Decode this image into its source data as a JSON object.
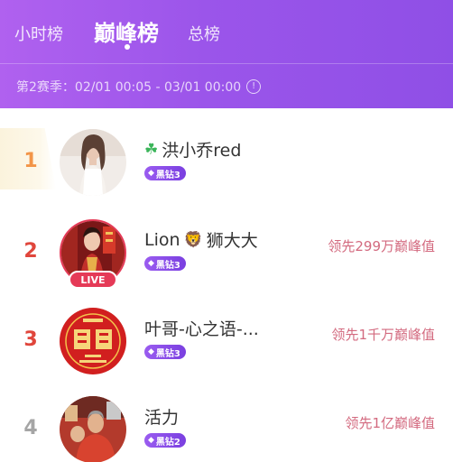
{
  "tabs": [
    {
      "label": "小时榜",
      "active": false
    },
    {
      "label": "巅峰榜",
      "active": true
    },
    {
      "label": "总榜",
      "active": false
    }
  ],
  "season": {
    "text": "第2赛季：02/01 00:05 - 03/01 00:00",
    "icon": "info-icon"
  },
  "rows": [
    {
      "rank": "1",
      "name": "洪小乔red",
      "prefix_icon": "clover-icon",
      "tier": "黑钻3",
      "lead": "",
      "live": false
    },
    {
      "rank": "2",
      "name_pre": "Lion",
      "name_post": "狮大大",
      "emoji": "lion-emoji",
      "tier": "黑钻3",
      "lead": "领先299万巅峰值",
      "live": true,
      "live_label": "LIVE"
    },
    {
      "rank": "3",
      "name": "叶哥-心之语-...",
      "tier": "黑钻3",
      "lead": "领先1千万巅峰值",
      "live": false
    },
    {
      "rank": "4",
      "name": "活力",
      "tier": "黑钻2",
      "lead": "领先1亿巅峰值",
      "live": false
    }
  ],
  "colors": {
    "header_start": "#b061ef",
    "header_end": "#8f4fe6",
    "rank_red": "#e0463c",
    "rank_orange": "#f29548",
    "lead_text": "#d36a7f",
    "tier_badge": "#8a4ae8"
  }
}
